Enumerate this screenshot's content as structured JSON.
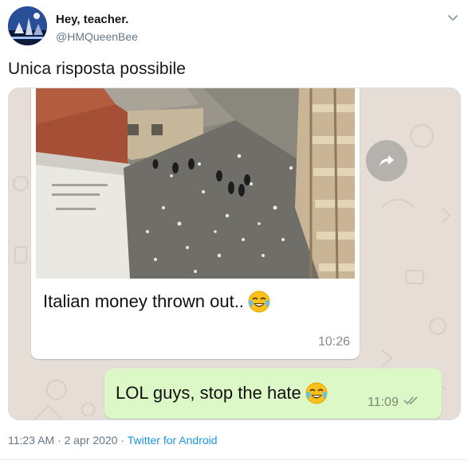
{
  "user": {
    "display_name": "Hey, teacher.",
    "handle": "@HMQueenBee"
  },
  "tweet": {
    "text": "Unica risposta possibile"
  },
  "chat": {
    "incoming_caption": "Italian money thrown out..",
    "incoming_emoji": "face-with-tears-of-joy",
    "incoming_time": "10:26",
    "outgoing_text": "LOL guys, stop the hate",
    "outgoing_emoji": "face-with-tears-of-joy",
    "outgoing_time": "11:09",
    "outgoing_status_icon": "double-check-icon",
    "colors": {
      "outgoing_bubble": "#dcf8c6",
      "incoming_bubble": "#ffffff",
      "wallpaper": "#e6ded6"
    }
  },
  "footer": {
    "time": "11:23 AM",
    "separator": "·",
    "date": "2 apr 2020",
    "source": "Twitter for Android",
    "source_color": "#1b95e0"
  }
}
